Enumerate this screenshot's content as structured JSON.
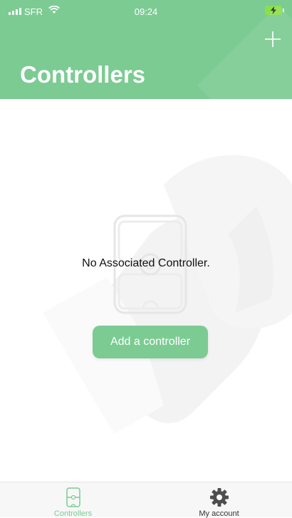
{
  "status_bar": {
    "carrier": "SFR",
    "time": "09:24",
    "signal_icon": "signal-bars-icon",
    "wifi_icon": "wifi-icon",
    "battery_icon": "battery-charging-icon"
  },
  "header": {
    "title": "Controllers",
    "add_icon": "plus-icon",
    "background_color": "#7ccb93"
  },
  "main": {
    "empty_icon": "controller-outline-icon",
    "empty_message": "No Associated Controller.",
    "add_button_label": "Add a controller"
  },
  "tabbar": {
    "tabs": [
      {
        "label": "Controllers",
        "icon": "controller-icon",
        "active": true,
        "color": "#7ccb93"
      },
      {
        "label": "My account",
        "icon": "gear-icon",
        "active": false,
        "color": "#333333"
      }
    ]
  },
  "colors": {
    "accent": "#7ccb93",
    "text": "#111111"
  }
}
